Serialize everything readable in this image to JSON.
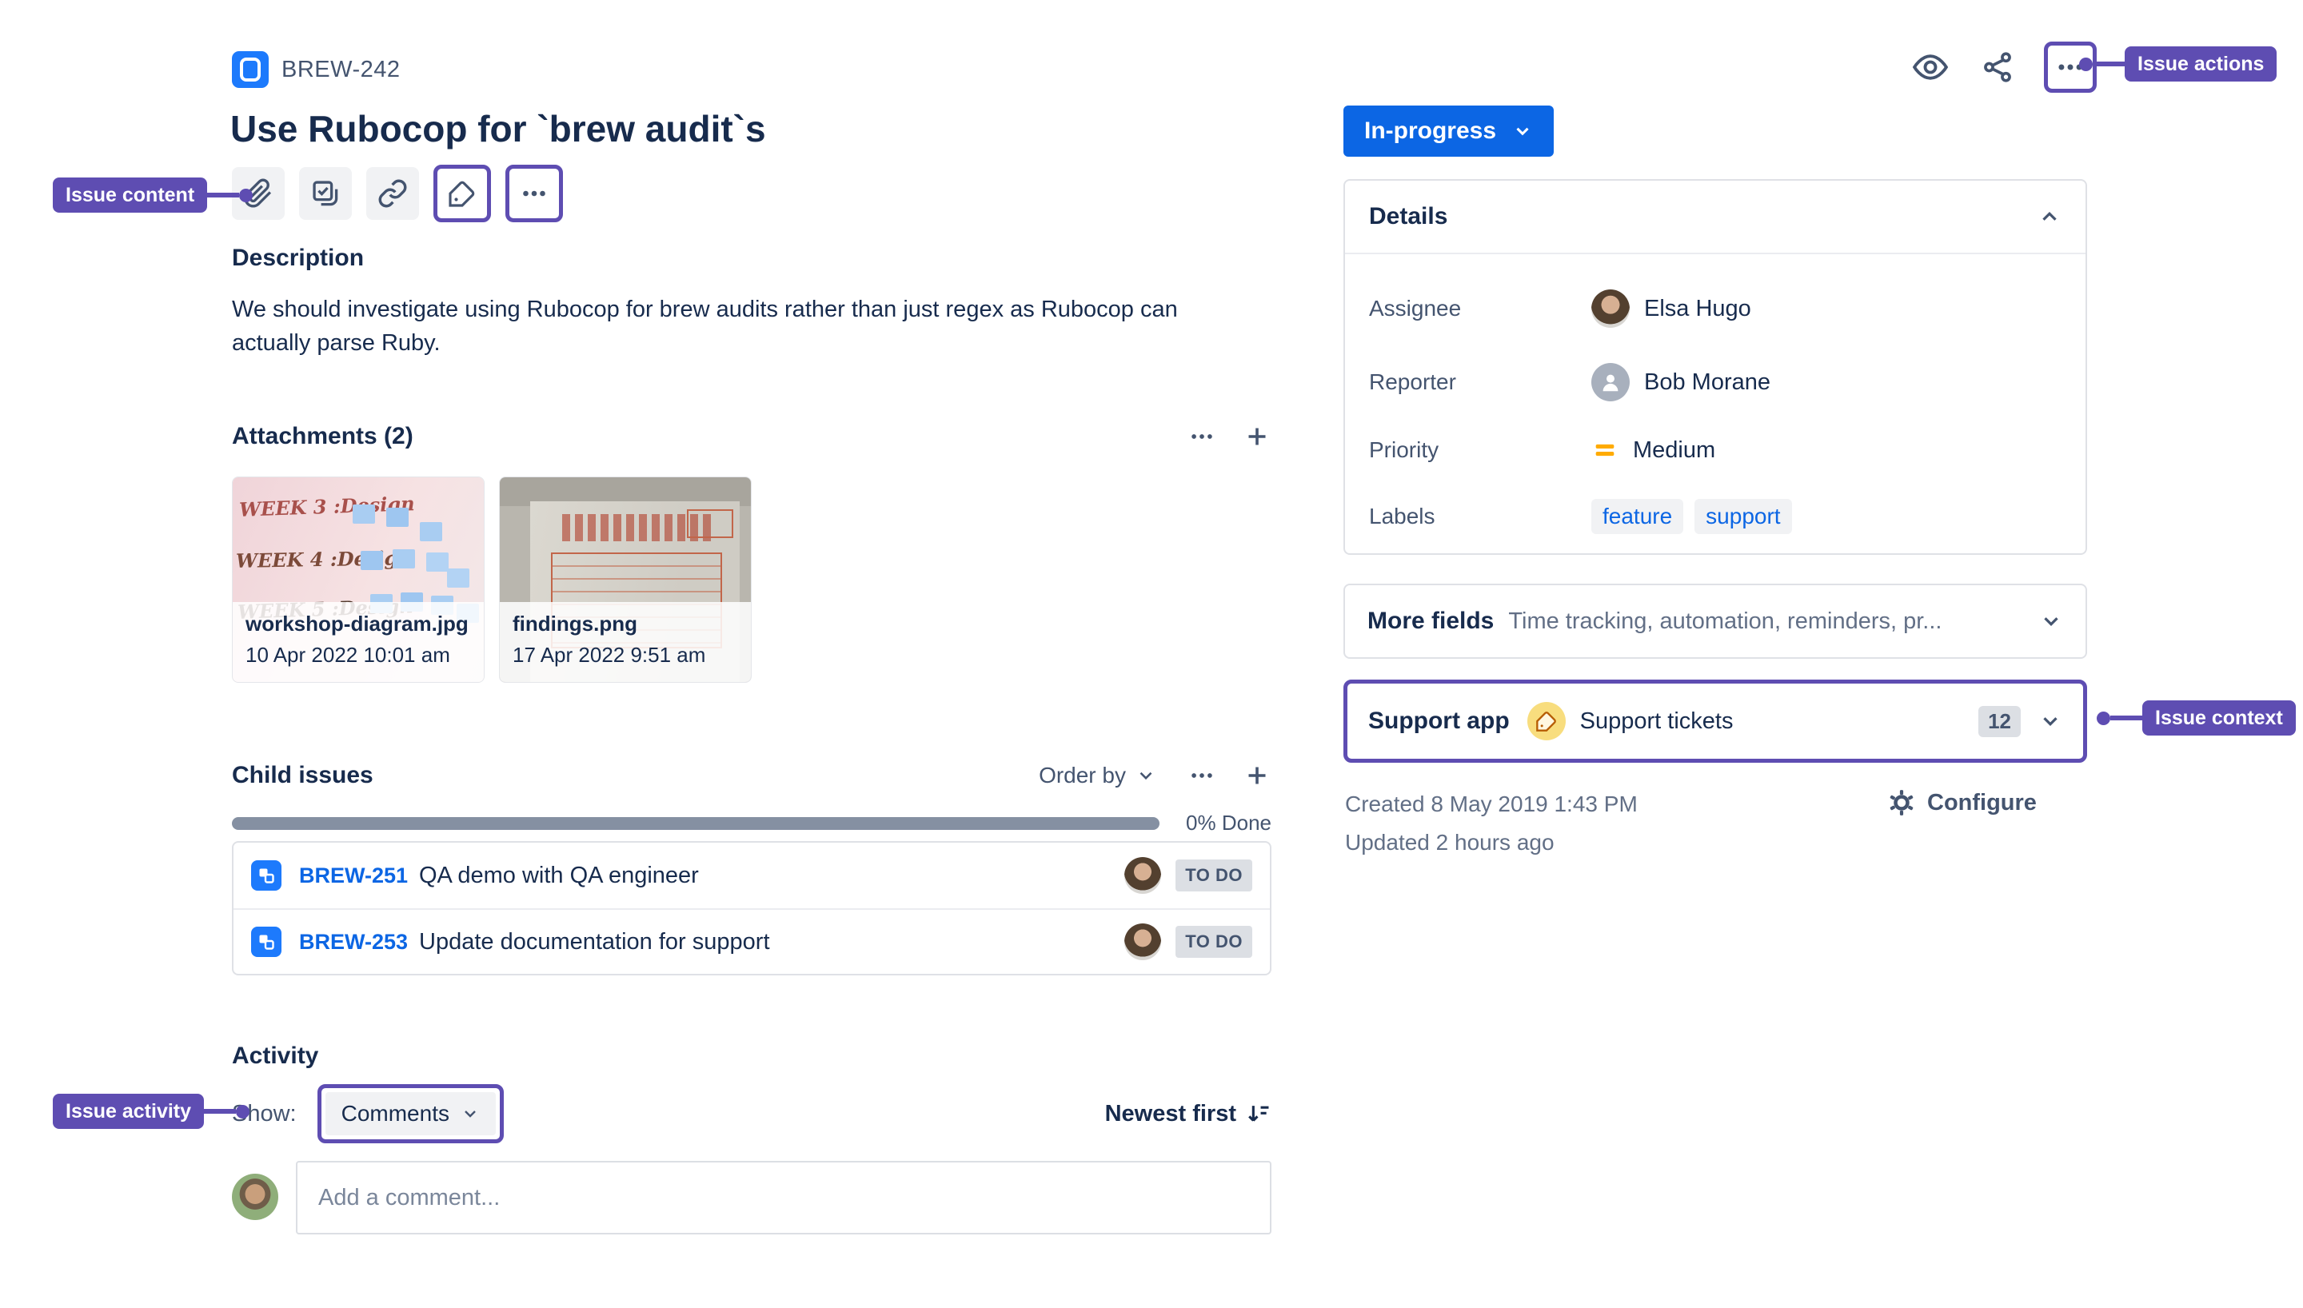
{
  "colors": {
    "accent_blue": "#0C66E4",
    "issue_type_blue": "#1D7AFC",
    "annotation_purple": "#5E4DB2",
    "text_primary": "#172B4D",
    "text_secondary": "#44546F",
    "text_muted": "#626F86",
    "chip_bg": "#F1F2F4",
    "lozenge_bg": "#DCDFE4",
    "card_border": "#DFE1E6",
    "progress_track": "#8590A2",
    "priority_medium": "#FFAB00",
    "support_icon_bg": "#F8DD7E",
    "support_icon_glyph": "#B65C02"
  },
  "annotations": {
    "content": "Issue content",
    "actions": "Issue actions",
    "context": "Issue context",
    "activity": "Issue activity"
  },
  "header": {
    "issue_key": "BREW-242",
    "title": "Use Rubocop for `brew audit`s"
  },
  "status": {
    "label": "In-progress"
  },
  "description": {
    "heading": "Description",
    "body": "We should investigate using Rubocop for brew audits rather than just regex as Rubocop can actually parse Ruby."
  },
  "attachments": {
    "heading": "Attachments (2)",
    "items": [
      {
        "filename": "workshop-diagram.jpg",
        "date": "10 Apr 2022 10:01 am",
        "scribbles": [
          "WEEK 3 :Design",
          "WEEK 4 :Design",
          "WEEK 5 :Design"
        ]
      },
      {
        "filename": "findings.png",
        "date": "17 Apr 2022 9:51 am"
      }
    ]
  },
  "child_issues": {
    "heading": "Child issues",
    "order_by_label": "Order by",
    "progress_label": "0% Done",
    "items": [
      {
        "key": "BREW-251",
        "summary": "QA demo with QA engineer",
        "status": "TO DO"
      },
      {
        "key": "BREW-253",
        "summary": "Update documentation for support",
        "status": "TO DO"
      }
    ]
  },
  "activity": {
    "heading": "Activity",
    "show_label": "Show:",
    "filter_value": "Comments",
    "sort_label": "Newest first",
    "comment_placeholder": "Add a comment..."
  },
  "details": {
    "heading": "Details",
    "assignee_label": "Assignee",
    "assignee_value": "Elsa Hugo",
    "reporter_label": "Reporter",
    "reporter_value": "Bob Morane",
    "priority_label": "Priority",
    "priority_value": "Medium",
    "labels_label": "Labels",
    "labels": [
      "feature",
      "support"
    ]
  },
  "more_fields": {
    "label": "More fields",
    "summary": "Time tracking, automation, reminders, pr..."
  },
  "support_app": {
    "label": "Support app",
    "name": "Support tickets",
    "count": "12"
  },
  "meta": {
    "created": "Created 8 May 2019 1:43 PM",
    "updated": "Updated 2 hours ago",
    "configure_label": "Configure"
  }
}
